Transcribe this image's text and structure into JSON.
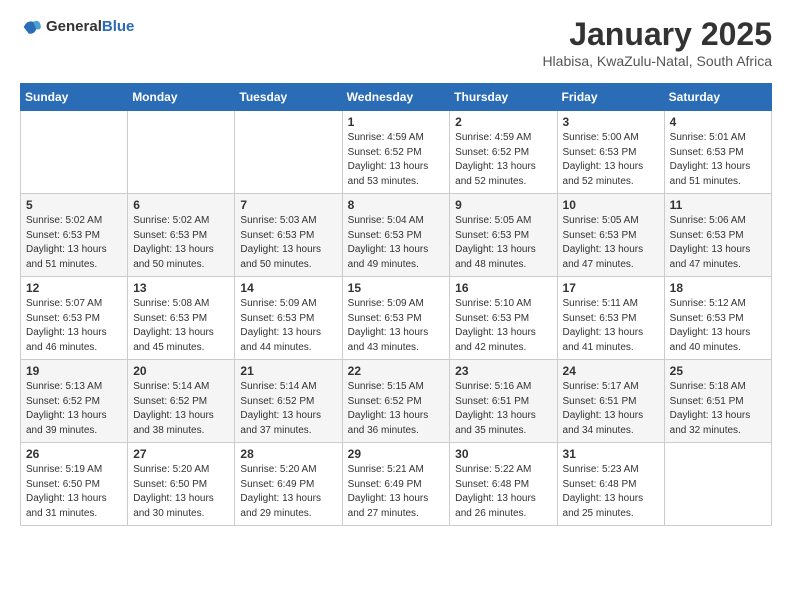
{
  "header": {
    "logo_general": "General",
    "logo_blue": "Blue",
    "month_title": "January 2025",
    "subtitle": "Hlabisa, KwaZulu-Natal, South Africa"
  },
  "weekdays": [
    "Sunday",
    "Monday",
    "Tuesday",
    "Wednesday",
    "Thursday",
    "Friday",
    "Saturday"
  ],
  "weeks": [
    [
      {
        "day": "",
        "info": ""
      },
      {
        "day": "",
        "info": ""
      },
      {
        "day": "",
        "info": ""
      },
      {
        "day": "1",
        "info": "Sunrise: 4:59 AM\nSunset: 6:52 PM\nDaylight: 13 hours\nand 53 minutes."
      },
      {
        "day": "2",
        "info": "Sunrise: 4:59 AM\nSunset: 6:52 PM\nDaylight: 13 hours\nand 52 minutes."
      },
      {
        "day": "3",
        "info": "Sunrise: 5:00 AM\nSunset: 6:53 PM\nDaylight: 13 hours\nand 52 minutes."
      },
      {
        "day": "4",
        "info": "Sunrise: 5:01 AM\nSunset: 6:53 PM\nDaylight: 13 hours\nand 51 minutes."
      }
    ],
    [
      {
        "day": "5",
        "info": "Sunrise: 5:02 AM\nSunset: 6:53 PM\nDaylight: 13 hours\nand 51 minutes."
      },
      {
        "day": "6",
        "info": "Sunrise: 5:02 AM\nSunset: 6:53 PM\nDaylight: 13 hours\nand 50 minutes."
      },
      {
        "day": "7",
        "info": "Sunrise: 5:03 AM\nSunset: 6:53 PM\nDaylight: 13 hours\nand 50 minutes."
      },
      {
        "day": "8",
        "info": "Sunrise: 5:04 AM\nSunset: 6:53 PM\nDaylight: 13 hours\nand 49 minutes."
      },
      {
        "day": "9",
        "info": "Sunrise: 5:05 AM\nSunset: 6:53 PM\nDaylight: 13 hours\nand 48 minutes."
      },
      {
        "day": "10",
        "info": "Sunrise: 5:05 AM\nSunset: 6:53 PM\nDaylight: 13 hours\nand 47 minutes."
      },
      {
        "day": "11",
        "info": "Sunrise: 5:06 AM\nSunset: 6:53 PM\nDaylight: 13 hours\nand 47 minutes."
      }
    ],
    [
      {
        "day": "12",
        "info": "Sunrise: 5:07 AM\nSunset: 6:53 PM\nDaylight: 13 hours\nand 46 minutes."
      },
      {
        "day": "13",
        "info": "Sunrise: 5:08 AM\nSunset: 6:53 PM\nDaylight: 13 hours\nand 45 minutes."
      },
      {
        "day": "14",
        "info": "Sunrise: 5:09 AM\nSunset: 6:53 PM\nDaylight: 13 hours\nand 44 minutes."
      },
      {
        "day": "15",
        "info": "Sunrise: 5:09 AM\nSunset: 6:53 PM\nDaylight: 13 hours\nand 43 minutes."
      },
      {
        "day": "16",
        "info": "Sunrise: 5:10 AM\nSunset: 6:53 PM\nDaylight: 13 hours\nand 42 minutes."
      },
      {
        "day": "17",
        "info": "Sunrise: 5:11 AM\nSunset: 6:53 PM\nDaylight: 13 hours\nand 41 minutes."
      },
      {
        "day": "18",
        "info": "Sunrise: 5:12 AM\nSunset: 6:53 PM\nDaylight: 13 hours\nand 40 minutes."
      }
    ],
    [
      {
        "day": "19",
        "info": "Sunrise: 5:13 AM\nSunset: 6:52 PM\nDaylight: 13 hours\nand 39 minutes."
      },
      {
        "day": "20",
        "info": "Sunrise: 5:14 AM\nSunset: 6:52 PM\nDaylight: 13 hours\nand 38 minutes."
      },
      {
        "day": "21",
        "info": "Sunrise: 5:14 AM\nSunset: 6:52 PM\nDaylight: 13 hours\nand 37 minutes."
      },
      {
        "day": "22",
        "info": "Sunrise: 5:15 AM\nSunset: 6:52 PM\nDaylight: 13 hours\nand 36 minutes."
      },
      {
        "day": "23",
        "info": "Sunrise: 5:16 AM\nSunset: 6:51 PM\nDaylight: 13 hours\nand 35 minutes."
      },
      {
        "day": "24",
        "info": "Sunrise: 5:17 AM\nSunset: 6:51 PM\nDaylight: 13 hours\nand 34 minutes."
      },
      {
        "day": "25",
        "info": "Sunrise: 5:18 AM\nSunset: 6:51 PM\nDaylight: 13 hours\nand 32 minutes."
      }
    ],
    [
      {
        "day": "26",
        "info": "Sunrise: 5:19 AM\nSunset: 6:50 PM\nDaylight: 13 hours\nand 31 minutes."
      },
      {
        "day": "27",
        "info": "Sunrise: 5:20 AM\nSunset: 6:50 PM\nDaylight: 13 hours\nand 30 minutes."
      },
      {
        "day": "28",
        "info": "Sunrise: 5:20 AM\nSunset: 6:49 PM\nDaylight: 13 hours\nand 29 minutes."
      },
      {
        "day": "29",
        "info": "Sunrise: 5:21 AM\nSunset: 6:49 PM\nDaylight: 13 hours\nand 27 minutes."
      },
      {
        "day": "30",
        "info": "Sunrise: 5:22 AM\nSunset: 6:48 PM\nDaylight: 13 hours\nand 26 minutes."
      },
      {
        "day": "31",
        "info": "Sunrise: 5:23 AM\nSunset: 6:48 PM\nDaylight: 13 hours\nand 25 minutes."
      },
      {
        "day": "",
        "info": ""
      }
    ]
  ]
}
